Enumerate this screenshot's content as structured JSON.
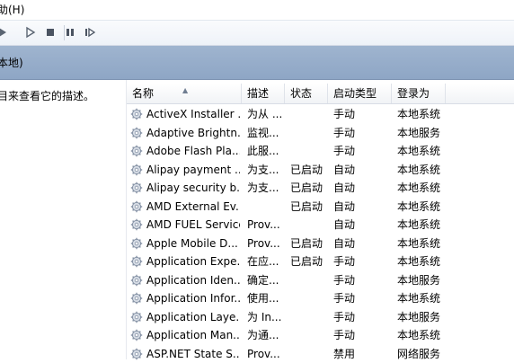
{
  "menubar": {
    "help_label": "助(H)"
  },
  "toolbar": {
    "icons": [
      "play-icon",
      "play-outline-icon",
      "stop-icon",
      "pause-icon",
      "restart-icon"
    ]
  },
  "header": {
    "title": "本地)"
  },
  "left_pane": {
    "description": "目来查看它的描述。"
  },
  "columns": [
    "名称",
    "描述",
    "状态",
    "启动类型",
    "登录为"
  ],
  "rows": [
    {
      "name": "ActiveX Installer ...",
      "desc": "为从 ...",
      "status": "",
      "startup": "手动",
      "logon": "本地系统"
    },
    {
      "name": "Adaptive Brightn...",
      "desc": "监视...",
      "status": "",
      "startup": "手动",
      "logon": "本地服务"
    },
    {
      "name": "Adobe Flash Pla...",
      "desc": "此服...",
      "status": "",
      "startup": "手动",
      "logon": "本地系统"
    },
    {
      "name": "Alipay payment ...",
      "desc": "为支...",
      "status": "已启动",
      "startup": "自动",
      "logon": "本地系统"
    },
    {
      "name": "Alipay security b...",
      "desc": "为支...",
      "status": "已启动",
      "startup": "自动",
      "logon": "本地系统"
    },
    {
      "name": "AMD External Ev...",
      "desc": "",
      "status": "已启动",
      "startup": "自动",
      "logon": "本地系统"
    },
    {
      "name": "AMD FUEL Service",
      "desc": "Prov...",
      "status": "",
      "startup": "自动",
      "logon": "本地系统"
    },
    {
      "name": "Apple Mobile D...",
      "desc": "Prov...",
      "status": "已启动",
      "startup": "自动",
      "logon": "本地系统"
    },
    {
      "name": "Application Expe...",
      "desc": "在应...",
      "status": "已启动",
      "startup": "手动",
      "logon": "本地系统"
    },
    {
      "name": "Application Iden...",
      "desc": "确定...",
      "status": "",
      "startup": "手动",
      "logon": "本地服务"
    },
    {
      "name": "Application Infor...",
      "desc": "使用...",
      "status": "",
      "startup": "手动",
      "logon": "本地系统"
    },
    {
      "name": "Application Laye...",
      "desc": "为 In...",
      "status": "",
      "startup": "手动",
      "logon": "本地服务"
    },
    {
      "name": "Application Man...",
      "desc": "为通...",
      "status": "",
      "startup": "手动",
      "logon": "本地系统"
    },
    {
      "name": "ASP.NET State S...",
      "desc": "Prov...",
      "status": "",
      "startup": "禁用",
      "logon": "网络服务"
    }
  ]
}
